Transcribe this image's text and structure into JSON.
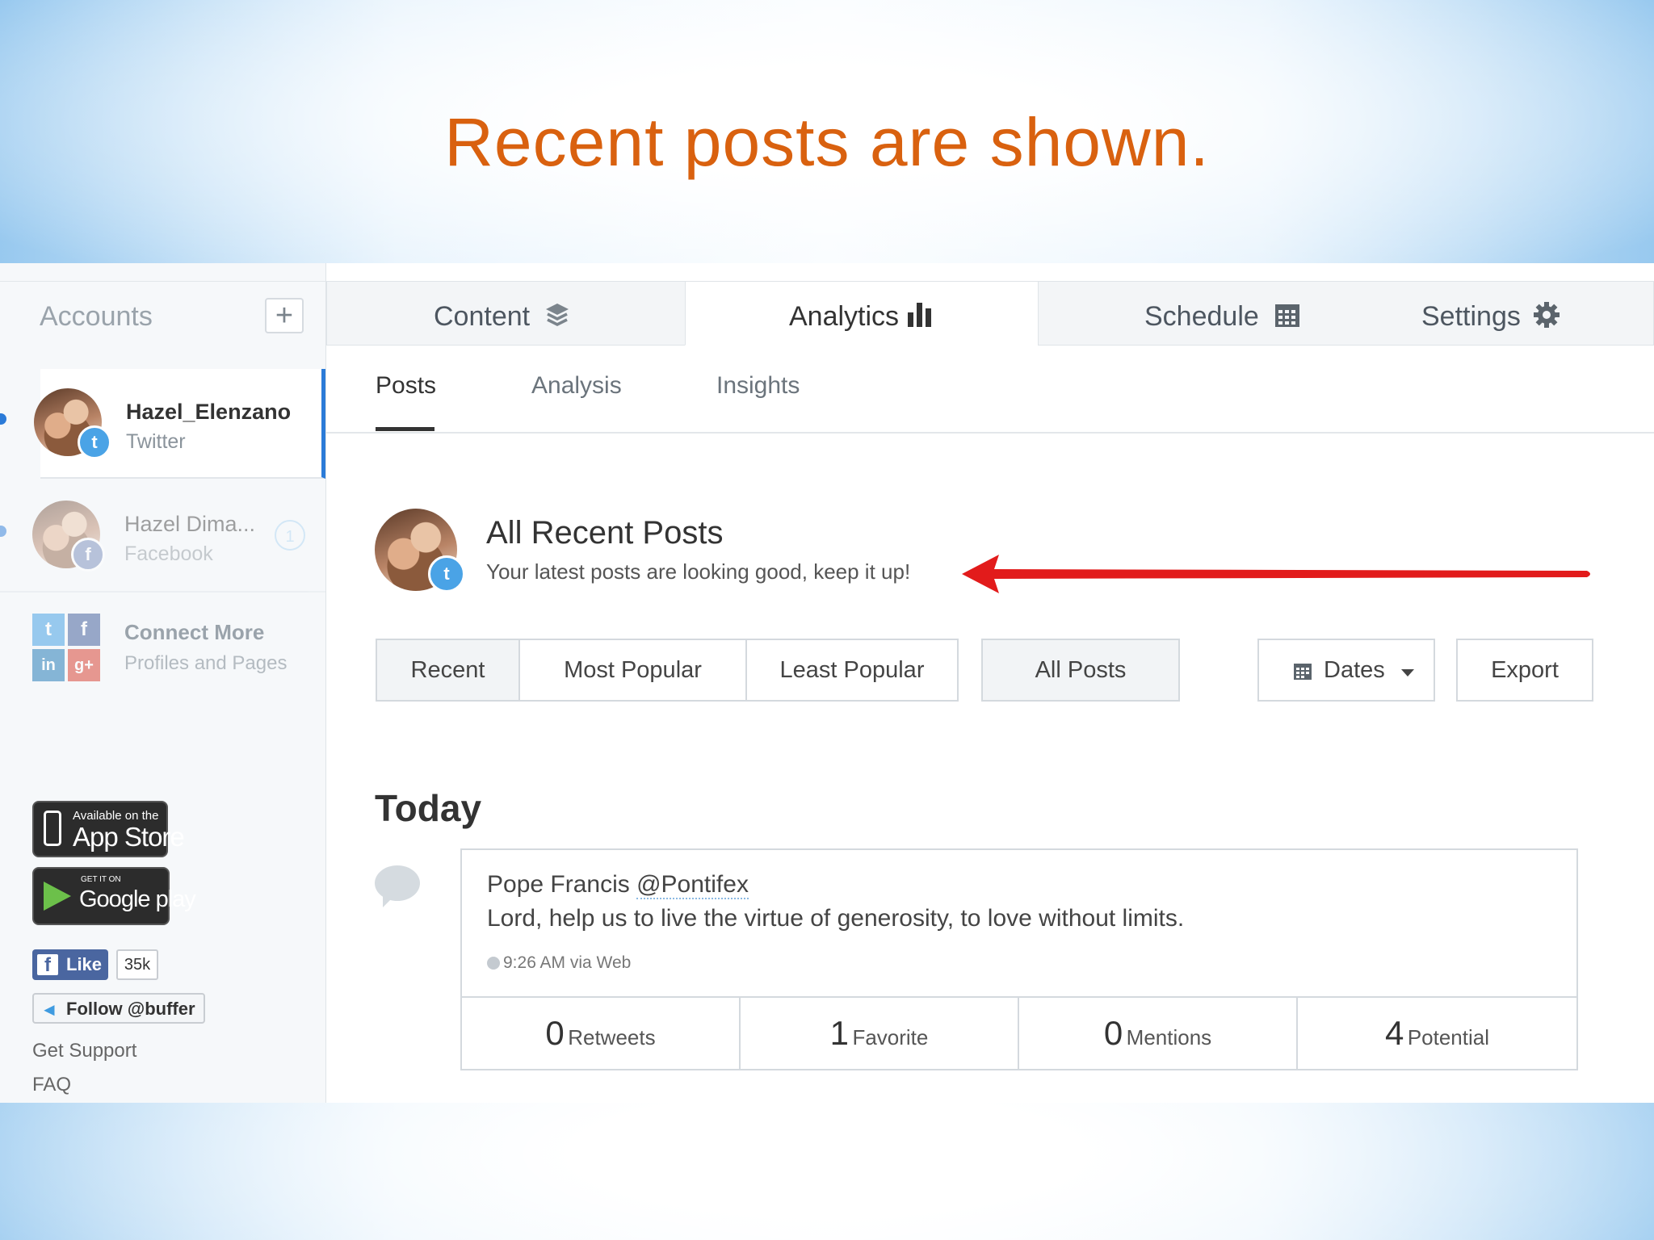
{
  "slide_title": "Recent posts are shown.",
  "sidebar": {
    "accounts_title": "Accounts",
    "add_label": "+",
    "accounts": [
      {
        "name": "Hazel_Elenzano",
        "network": "Twitter",
        "badge": "t"
      },
      {
        "name": "Hazel Dima...",
        "network": "Facebook",
        "badge": "f",
        "count": "1"
      }
    ],
    "connect_line1": "Connect More",
    "connect_line2": "Profiles and Pages",
    "connect_icons": [
      "t",
      "f",
      "in",
      "g+"
    ],
    "app_store_small": "Available on the",
    "app_store_big": "App Store",
    "google_small": "GET IT ON",
    "google_big": "Google play",
    "like_label": "Like",
    "like_count": "35k",
    "follow_label": "Follow @buffer",
    "links": [
      "Get Support",
      "FAQ"
    ]
  },
  "topnav": {
    "tabs": [
      {
        "label": "Content",
        "icon": "layers-icon"
      },
      {
        "label": "Analytics",
        "icon": "bar-chart-icon"
      },
      {
        "label": "Schedule",
        "icon": "calendar-icon"
      },
      {
        "label": "Settings",
        "icon": "gear-icon"
      }
    ],
    "active": "Analytics"
  },
  "subtabs": [
    "Posts",
    "Analysis",
    "Insights"
  ],
  "header": {
    "title": "All Recent Posts",
    "subtitle": "Your latest posts are looking good, keep it up!"
  },
  "filters": {
    "sort": [
      "Recent",
      "Most Popular",
      "Least Popular"
    ],
    "selected_sort": "Recent",
    "all_posts": "All Posts",
    "dates": "Dates",
    "export": "Export"
  },
  "feed": {
    "group": "Today",
    "post": {
      "author": "Pope Francis",
      "handle": "@Pontifex",
      "text": "Lord, help us to live the virtue of generosity, to love without limits.",
      "meta": "9:26 AM via Web",
      "stats": [
        {
          "num": "0",
          "label": "Retweets"
        },
        {
          "num": "1",
          "label": "Favorite"
        },
        {
          "num": "0",
          "label": "Mentions"
        },
        {
          "num": "4",
          "label": "Potential"
        }
      ]
    }
  },
  "colors": {
    "title": "#d9610f",
    "accent": "#2b7bd8",
    "arrow": "#e21b1b",
    "twitter": "#4aa3e6",
    "facebook": "#6b82b5"
  }
}
